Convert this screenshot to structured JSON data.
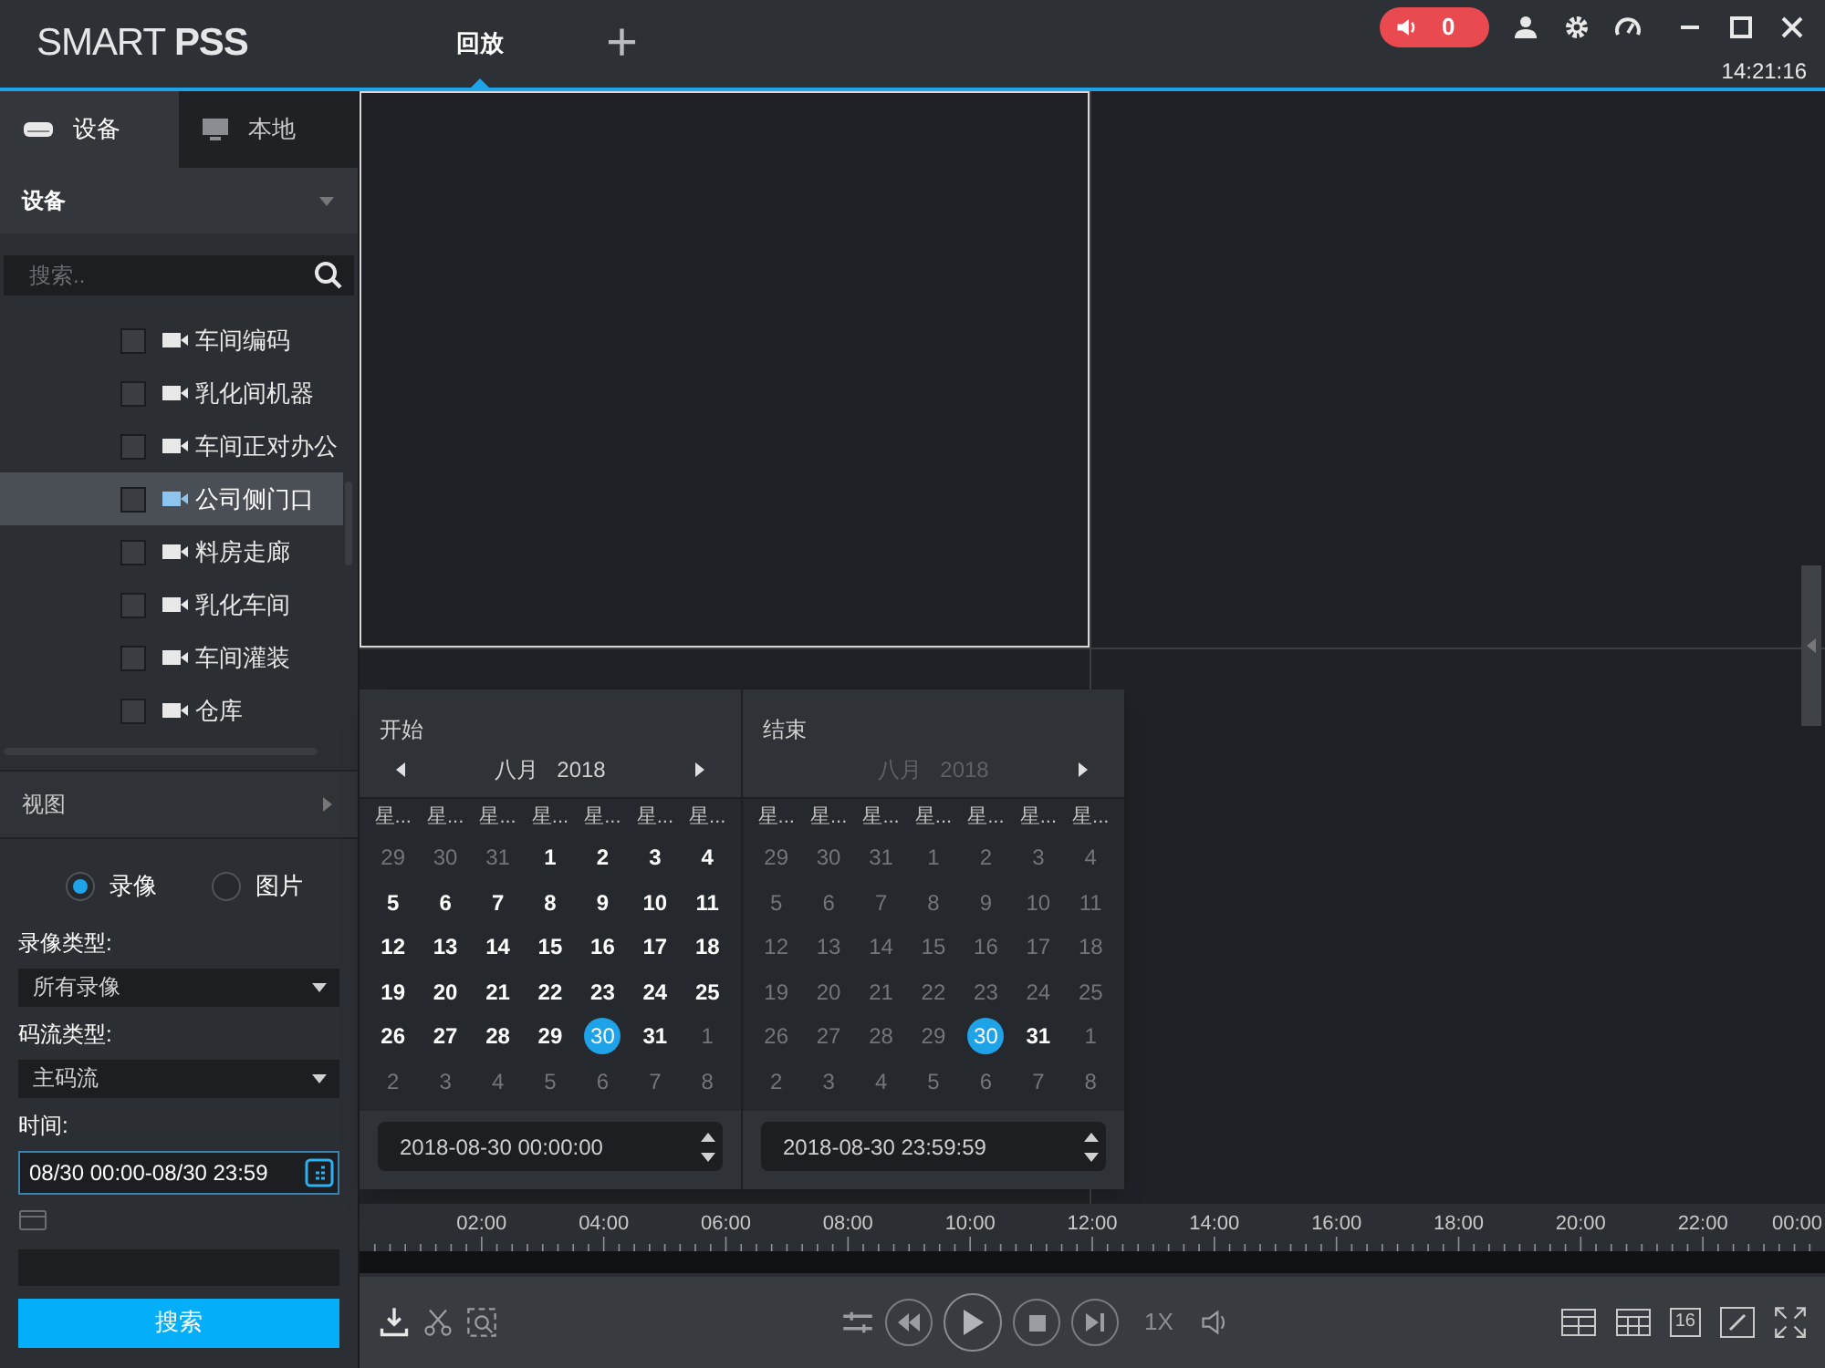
{
  "title_bar": {
    "logo": "SMART **PSS**",
    "tabs": [
      {
        "label": "回放",
        "selected": true
      }
    ],
    "add_tab": "+",
    "alarm_count": "0",
    "clock": "14:21:16"
  },
  "sidebar": {
    "tabs": [
      {
        "label": "设备",
        "kind": "device",
        "selected": true
      },
      {
        "label": "本地",
        "kind": "local",
        "selected": false
      }
    ],
    "device_header": "设备",
    "search": {
      "placeholder": "搜索.."
    },
    "devices": [
      {
        "name": "车间编码",
        "checked": false,
        "selected": false
      },
      {
        "name": "乳化间机器",
        "checked": false,
        "selected": false
      },
      {
        "name": "车间正对办公",
        "checked": false,
        "selected": false
      },
      {
        "name": "公司侧门口",
        "checked": false,
        "selected": true
      },
      {
        "name": "料房走廊",
        "checked": false,
        "selected": false
      },
      {
        "name": "乳化车间",
        "checked": false,
        "selected": false
      },
      {
        "name": "车间灌装",
        "checked": false,
        "selected": false
      },
      {
        "name": "仓库",
        "checked": false,
        "selected": false
      }
    ],
    "view_header": "视图",
    "modes": [
      {
        "label": "录像",
        "selected": true
      },
      {
        "label": "图片",
        "selected": false
      }
    ],
    "record_type_label": "录像类型:",
    "record_type": "所有录像",
    "stream_type_label": "码流类型:",
    "stream_type": "主码流",
    "time_label": "时间:",
    "time_value": "08/30 00:00-08/30 23:59",
    "search_button": "搜索"
  },
  "calendars": [
    {
      "label": "开始",
      "month": "八月",
      "year": "2018",
      "header_dimmed": false,
      "weekdays": [
        "星...",
        "星...",
        "星...",
        "星...",
        "星...",
        "星...",
        "星..."
      ],
      "weeks": [
        [
          {
            "d": "29",
            "dim": true,
            "selected": false
          },
          {
            "d": "30",
            "dim": true,
            "selected": false
          },
          {
            "d": "31",
            "dim": true,
            "selected": false
          },
          {
            "d": "1",
            "dim": false,
            "selected": false
          },
          {
            "d": "2",
            "dim": false,
            "selected": false
          },
          {
            "d": "3",
            "dim": false,
            "selected": false
          },
          {
            "d": "4",
            "dim": false,
            "selected": false
          }
        ],
        [
          {
            "d": "5",
            "dim": false,
            "selected": false
          },
          {
            "d": "6",
            "dim": false,
            "selected": false
          },
          {
            "d": "7",
            "dim": false,
            "selected": false
          },
          {
            "d": "8",
            "dim": false,
            "selected": false
          },
          {
            "d": "9",
            "dim": false,
            "selected": false
          },
          {
            "d": "10",
            "dim": false,
            "selected": false
          },
          {
            "d": "11",
            "dim": false,
            "selected": false
          }
        ],
        [
          {
            "d": "12",
            "dim": false,
            "selected": false
          },
          {
            "d": "13",
            "dim": false,
            "selected": false
          },
          {
            "d": "14",
            "dim": false,
            "selected": false
          },
          {
            "d": "15",
            "dim": false,
            "selected": false
          },
          {
            "d": "16",
            "dim": false,
            "selected": false
          },
          {
            "d": "17",
            "dim": false,
            "selected": false
          },
          {
            "d": "18",
            "dim": false,
            "selected": false
          }
        ],
        [
          {
            "d": "19",
            "dim": false,
            "selected": false
          },
          {
            "d": "20",
            "dim": false,
            "selected": false
          },
          {
            "d": "21",
            "dim": false,
            "selected": false
          },
          {
            "d": "22",
            "dim": false,
            "selected": false
          },
          {
            "d": "23",
            "dim": false,
            "selected": false
          },
          {
            "d": "24",
            "dim": false,
            "selected": false
          },
          {
            "d": "25",
            "dim": false,
            "selected": false
          }
        ],
        [
          {
            "d": "26",
            "dim": false,
            "selected": false
          },
          {
            "d": "27",
            "dim": false,
            "selected": false
          },
          {
            "d": "28",
            "dim": false,
            "selected": false
          },
          {
            "d": "29",
            "dim": false,
            "selected": false
          },
          {
            "d": "30",
            "dim": false,
            "selected": true
          },
          {
            "d": "31",
            "dim": false,
            "selected": false
          },
          {
            "d": "1",
            "dim": true,
            "selected": false
          }
        ],
        [
          {
            "d": "2",
            "dim": true,
            "selected": false
          },
          {
            "d": "3",
            "dim": true,
            "selected": false
          },
          {
            "d": "4",
            "dim": true,
            "selected": false
          },
          {
            "d": "5",
            "dim": true,
            "selected": false
          },
          {
            "d": "6",
            "dim": true,
            "selected": false
          },
          {
            "d": "7",
            "dim": true,
            "selected": false
          },
          {
            "d": "8",
            "dim": true,
            "selected": false
          }
        ]
      ],
      "time": "2018-08-30 00:00:00"
    },
    {
      "label": "结束",
      "month": "八月",
      "year": "2018",
      "header_dimmed": true,
      "weekdays": [
        "星...",
        "星...",
        "星...",
        "星...",
        "星...",
        "星...",
        "星..."
      ],
      "weeks": [
        [
          {
            "d": "29",
            "dim": true,
            "selected": false
          },
          {
            "d": "30",
            "dim": true,
            "selected": false
          },
          {
            "d": "31",
            "dim": true,
            "selected": false
          },
          {
            "d": "1",
            "dim": true,
            "selected": false
          },
          {
            "d": "2",
            "dim": true,
            "selected": false
          },
          {
            "d": "3",
            "dim": true,
            "selected": false
          },
          {
            "d": "4",
            "dim": true,
            "selected": false
          }
        ],
        [
          {
            "d": "5",
            "dim": true,
            "selected": false
          },
          {
            "d": "6",
            "dim": true,
            "selected": false
          },
          {
            "d": "7",
            "dim": true,
            "selected": false
          },
          {
            "d": "8",
            "dim": true,
            "selected": false
          },
          {
            "d": "9",
            "dim": true,
            "selected": false
          },
          {
            "d": "10",
            "dim": true,
            "selected": false
          },
          {
            "d": "11",
            "dim": true,
            "selected": false
          }
        ],
        [
          {
            "d": "12",
            "dim": true,
            "selected": false
          },
          {
            "d": "13",
            "dim": true,
            "selected": false
          },
          {
            "d": "14",
            "dim": true,
            "selected": false
          },
          {
            "d": "15",
            "dim": true,
            "selected": false
          },
          {
            "d": "16",
            "dim": true,
            "selected": false
          },
          {
            "d": "17",
            "dim": true,
            "selected": false
          },
          {
            "d": "18",
            "dim": true,
            "selected": false
          }
        ],
        [
          {
            "d": "19",
            "dim": true,
            "selected": false
          },
          {
            "d": "20",
            "dim": true,
            "selected": false
          },
          {
            "d": "21",
            "dim": true,
            "selected": false
          },
          {
            "d": "22",
            "dim": true,
            "selected": false
          },
          {
            "d": "23",
            "dim": true,
            "selected": false
          },
          {
            "d": "24",
            "dim": true,
            "selected": false
          },
          {
            "d": "25",
            "dim": true,
            "selected": false
          }
        ],
        [
          {
            "d": "26",
            "dim": true,
            "selected": false
          },
          {
            "d": "27",
            "dim": true,
            "selected": false
          },
          {
            "d": "28",
            "dim": true,
            "selected": false
          },
          {
            "d": "29",
            "dim": true,
            "selected": false
          },
          {
            "d": "30",
            "dim": false,
            "selected": true
          },
          {
            "d": "31",
            "dim": false,
            "selected": false
          },
          {
            "d": "1",
            "dim": true,
            "selected": false
          }
        ],
        [
          {
            "d": "2",
            "dim": true,
            "selected": false
          },
          {
            "d": "3",
            "dim": true,
            "selected": false
          },
          {
            "d": "4",
            "dim": true,
            "selected": false
          },
          {
            "d": "5",
            "dim": true,
            "selected": false
          },
          {
            "d": "6",
            "dim": true,
            "selected": false
          },
          {
            "d": "7",
            "dim": true,
            "selected": false
          },
          {
            "d": "8",
            "dim": true,
            "selected": false
          }
        ]
      ],
      "time": "2018-08-30 23:59:59"
    }
  ],
  "video_panes": [
    {
      "selected": true
    },
    {
      "selected": false
    },
    {
      "selected": false
    },
    {
      "selected": false
    }
  ],
  "timeline": {
    "labels": [
      "02:00",
      "04:00",
      "06:00",
      "08:00",
      "10:00",
      "12:00",
      "14:00",
      "16:00",
      "18:00",
      "20:00",
      "22:00",
      "00:00"
    ]
  },
  "playback": {
    "speed": "1X",
    "layout_16": "16"
  }
}
